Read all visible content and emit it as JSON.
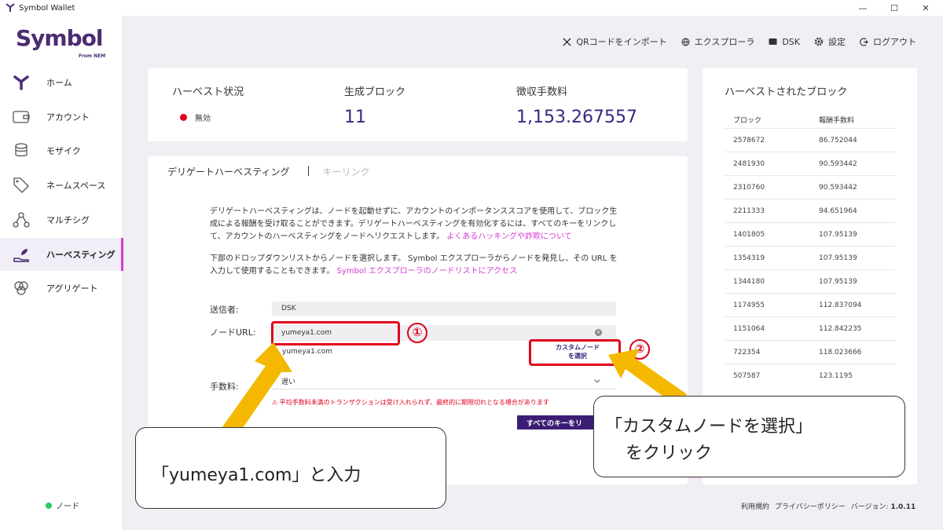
{
  "window": {
    "title": "Symbol Wallet",
    "minimize": "—",
    "maximize": "☐",
    "close": "✕"
  },
  "brand": {
    "name": "Symbol",
    "sub": "From NEM"
  },
  "sidebar": {
    "items": [
      {
        "label": "ホーム",
        "icon": "home-icon"
      },
      {
        "label": "アカウント",
        "icon": "wallet-icon"
      },
      {
        "label": "モザイク",
        "icon": "coins-icon"
      },
      {
        "label": "ネームスペース",
        "icon": "tag-icon"
      },
      {
        "label": "マルチシグ",
        "icon": "multisig-icon"
      },
      {
        "label": "ハーベスティング",
        "icon": "harvest-icon",
        "active": true
      },
      {
        "label": "アグリゲート",
        "icon": "aggregate-icon"
      }
    ],
    "node_label": "ノード"
  },
  "topbar": {
    "qr_import": "QRコードをインポート",
    "explorer": "エクスプローラ",
    "account": "DSK",
    "settings": "設定",
    "logout": "ログアウト"
  },
  "stats": {
    "status_label": "ハーベスト状況",
    "status_value": "無効",
    "blocks_label": "生成ブロック",
    "blocks_value": "11",
    "fees_label": "徴収手数料",
    "fees_value": "1,153.267557"
  },
  "tabs": {
    "delegated": "デリゲートハーベスティング",
    "separator": "|",
    "keylink": "キーリンク"
  },
  "description": {
    "p1": "デリゲートハーベスティングは、ノードを起動せずに、アカウントのインポータンススコアを使用して、ブロック生成による報酬を受け取ることができます。デリゲートハーベスティングを有効化するには、すべてのキーをリンクして、アカウントのハーベスティングをノードへリクエストします。",
    "p1_link": "よくあるハッキングや詐欺について",
    "p2": "下部のドロップダウンリストからノードを選択します。 Symbol エクスプローラからノードを発見し、その URL を入力して使用することもできます。",
    "p2_link": "Symbol エクスプローラのノードリストにアクセス"
  },
  "form": {
    "sender_label": "送信者:",
    "sender_value": "DSK",
    "node_url_label": "ノードURL:",
    "node_url_value": "yumeya1.com",
    "suggestion": "yumeya1.com",
    "custom_node_line1": "カスタムノード",
    "custom_node_line2": "を選択",
    "fee_label": "手数料:",
    "fee_value": "遅い",
    "warning": "⚠ 平均手数料未満のトランザクションは受け入れられず、最終的に期限切れとなる場合があります",
    "submit": "すべてのキーをリ"
  },
  "annotations": {
    "circle1": "①",
    "circle2": "②",
    "callout1": "「yumeya1.com」と入力",
    "callout2_line1": "「カスタムノードを選択」",
    "callout2_line2": "をクリック"
  },
  "harvested": {
    "title": "ハーベストされたブロック",
    "col_block": "ブロック",
    "col_fee": "報酬手数料",
    "rows": [
      {
        "block": "2578672",
        "fee": "86.752044"
      },
      {
        "block": "2481930",
        "fee": "90.593442"
      },
      {
        "block": "2310760",
        "fee": "90.593442"
      },
      {
        "block": "2211333",
        "fee": "94.651964"
      },
      {
        "block": "1401805",
        "fee": "107.95139"
      },
      {
        "block": "1354319",
        "fee": "107.95139"
      },
      {
        "block": "1344180",
        "fee": "107.95139"
      },
      {
        "block": "1174955",
        "fee": "112.837094"
      },
      {
        "block": "1151064",
        "fee": "112.842235"
      },
      {
        "block": "722354",
        "fee": "118.023666"
      },
      {
        "block": "507587",
        "fee": "123.1195"
      }
    ]
  },
  "footer": {
    "terms": "利用規約",
    "privacy": "プライバシーポリシー",
    "version_label": "バージョン:",
    "version": "1.0.11"
  },
  "colors": {
    "brand": "#4b2c73",
    "accent": "#d63ad1",
    "value": "#3b2680",
    "annotation": "#e0001b",
    "arrow": "#f5b800"
  }
}
